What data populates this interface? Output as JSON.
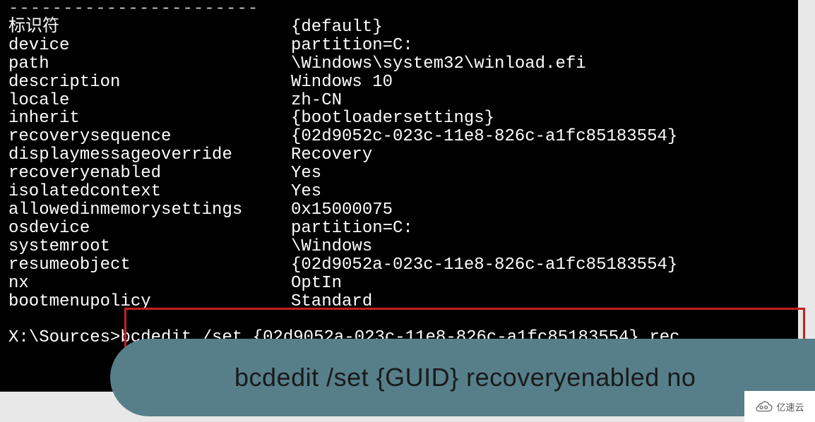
{
  "separator": "-----------------------",
  "entries": [
    {
      "key": "标识符",
      "value": "{default}"
    },
    {
      "key": "device",
      "value": "partition=C:"
    },
    {
      "key": "path",
      "value": "\\Windows\\system32\\winload.efi"
    },
    {
      "key": "description",
      "value": "Windows 10"
    },
    {
      "key": "locale",
      "value": "zh-CN"
    },
    {
      "key": "inherit",
      "value": "{bootloadersettings}"
    },
    {
      "key": "recoverysequence",
      "value": "{02d9052c-023c-11e8-826c-a1fc85183554}"
    },
    {
      "key": "displaymessageoverride",
      "value": "Recovery"
    },
    {
      "key": "recoveryenabled",
      "value": "Yes"
    },
    {
      "key": "isolatedcontext",
      "value": "Yes"
    },
    {
      "key": "allowedinmemorysettings",
      "value": "0x15000075"
    },
    {
      "key": "osdevice",
      "value": "partition=C:"
    },
    {
      "key": "systemroot",
      "value": "\\Windows"
    },
    {
      "key": "resumeobject",
      "value": "{02d9052a-023c-11e8-826c-a1fc85183554}"
    },
    {
      "key": "nx",
      "value": "OptIn"
    },
    {
      "key": "bootmenupolicy",
      "value": "Standard"
    }
  ],
  "prompt": "X:\\Sources>",
  "command": "bcdedit /set {02d9052a-023c-11e8-826c-a1fc85183554} rec",
  "callout": "bcdedit /set {GUID} recoveryenabled no",
  "watermark": "亿速云"
}
